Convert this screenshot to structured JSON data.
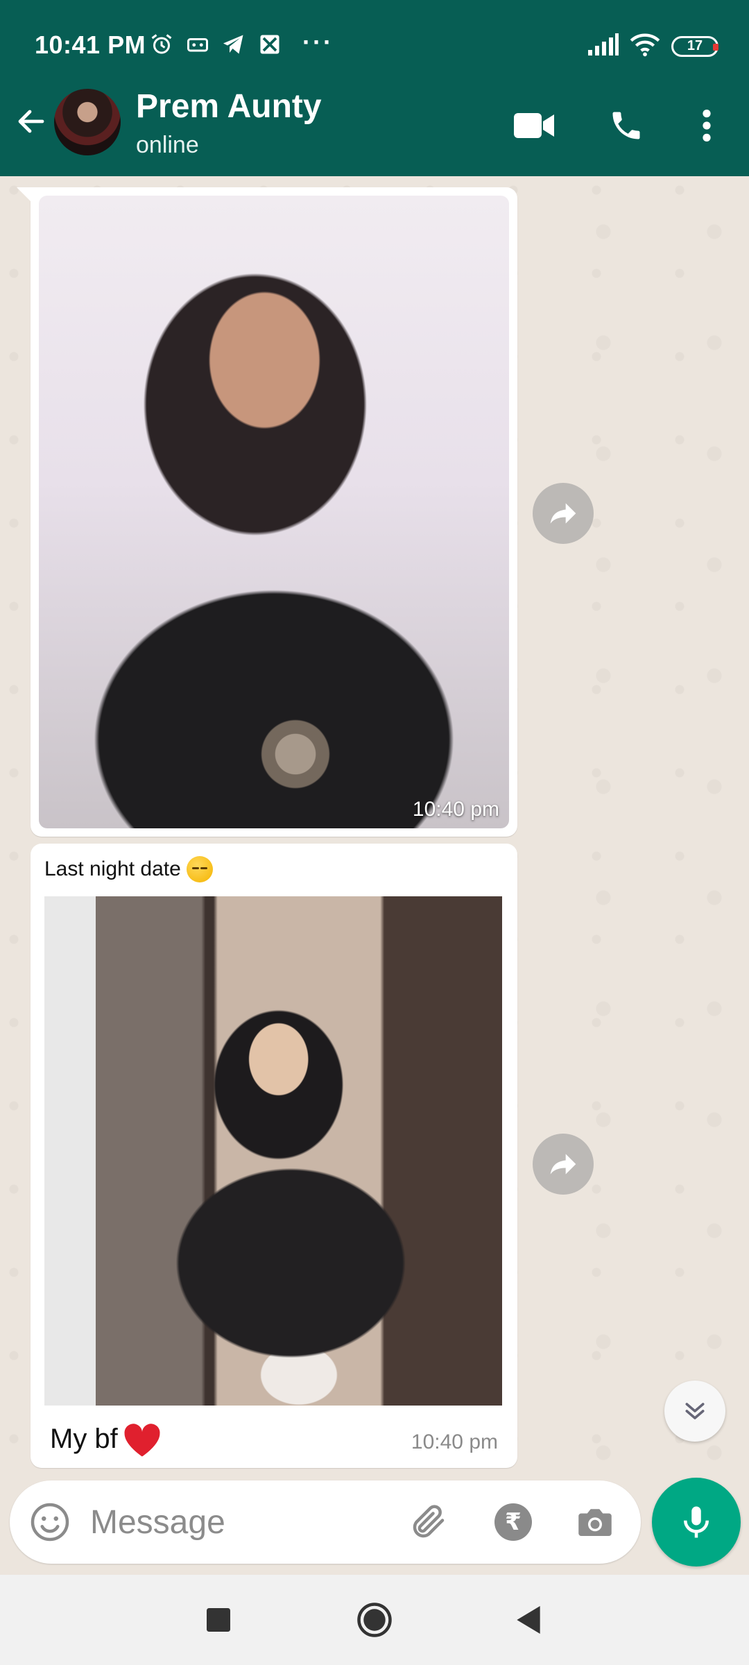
{
  "status_bar": {
    "time": "10:41 PM",
    "overflow": "···",
    "battery": "17"
  },
  "header": {
    "contact_name": "Prem Aunty",
    "contact_status": "online"
  },
  "messages": [
    {
      "type": "image",
      "time": "10:40 pm"
    },
    {
      "type": "image",
      "caption_top": "Last night date",
      "caption_bottom": "My bf",
      "time": "10:40 pm"
    }
  ],
  "input": {
    "placeholder": "Message"
  },
  "colors": {
    "header": "#075e54",
    "accent": "#00a884",
    "chat_bg": "#ece5dd"
  }
}
